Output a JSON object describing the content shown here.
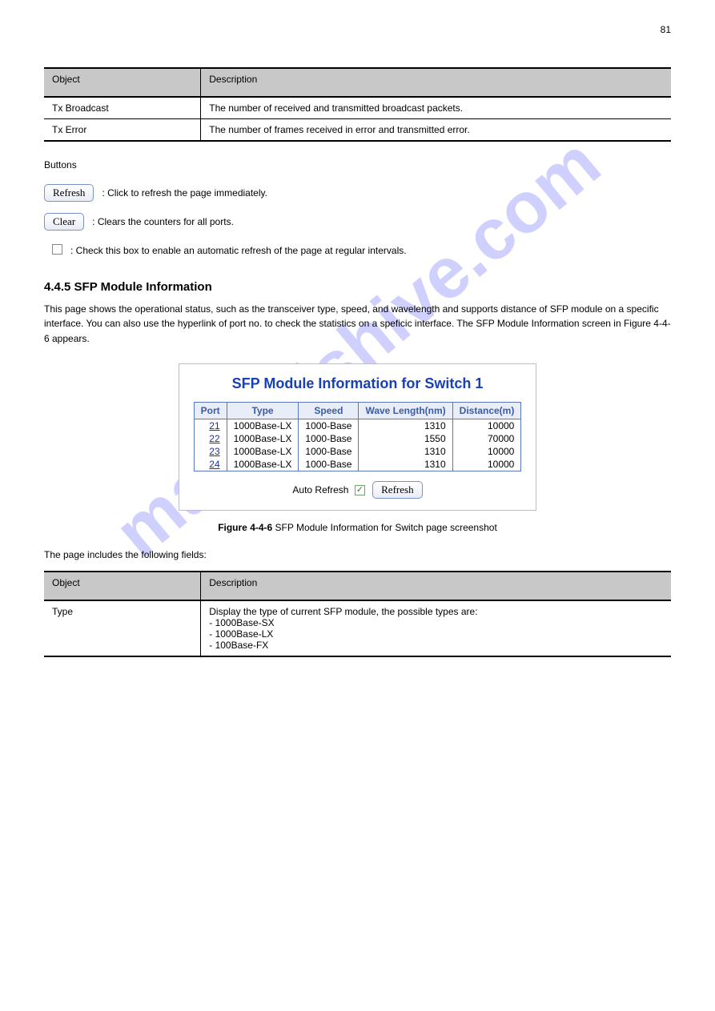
{
  "page_num": "81",
  "watermark": "manualshive.com",
  "term_table": {
    "headers": {
      "left": "Object",
      "right": "Description"
    },
    "rows": [
      {
        "left": "Tx Broadcast",
        "right": "The number of received and transmitted broadcast packets."
      },
      {
        "left": "Tx Error",
        "right": "The number of frames received in error and transmitted error."
      }
    ]
  },
  "buttons": {
    "refresh_label": "Refresh",
    "refresh_desc": ": Click to refresh the page immediately.",
    "clear_label": "Clear",
    "clear_desc": ": Clears the counters for all ports.",
    "auto_refresh_text": ": Check this box to enable an automatic refresh of the page at regular intervals."
  },
  "section": {
    "heading": "4.4.5 SFP Module Information",
    "para": "This page shows the operational status, such as the transceiver type, speed, and wavelength and supports distance of SFP module on a specific interface. You can also use the hyperlink of port no. to check the statistics on a speficic interface. The SFP Module Information screen in Figure 4-4-6 appears."
  },
  "module": {
    "title": "SFP Module Information for Switch 1",
    "columns": [
      "Port",
      "Type",
      "Speed",
      "Wave Length(nm)",
      "Distance(m)"
    ],
    "rows": [
      {
        "port": "21",
        "type": "1000Base-LX",
        "speed": "1000-Base",
        "wave": "1310",
        "dist": "10000"
      },
      {
        "port": "22",
        "type": "1000Base-LX",
        "speed": "1000-Base",
        "wave": "1550",
        "dist": "70000"
      },
      {
        "port": "23",
        "type": "1000Base-LX",
        "speed": "1000-Base",
        "wave": "1310",
        "dist": "10000"
      },
      {
        "port": "24",
        "type": "1000Base-LX",
        "speed": "1000-Base",
        "wave": "1310",
        "dist": "10000"
      }
    ],
    "auto_refresh_label": "Auto Refresh",
    "refresh_btn": "Refresh"
  },
  "figure_caption": {
    "bold": "Figure 4-4-6",
    "rest": " SFP Module Information for Switch page screenshot"
  },
  "intro_line": "The page includes the following fields:",
  "term_table2": {
    "headers": {
      "left": "Object",
      "right": "Description"
    },
    "rows": [
      {
        "left": "Type",
        "right": "Display the type of current SFP module, the possible types are:\n- 1000Base-SX\n- 1000Base-LX\n- 100Base-FX"
      }
    ]
  }
}
